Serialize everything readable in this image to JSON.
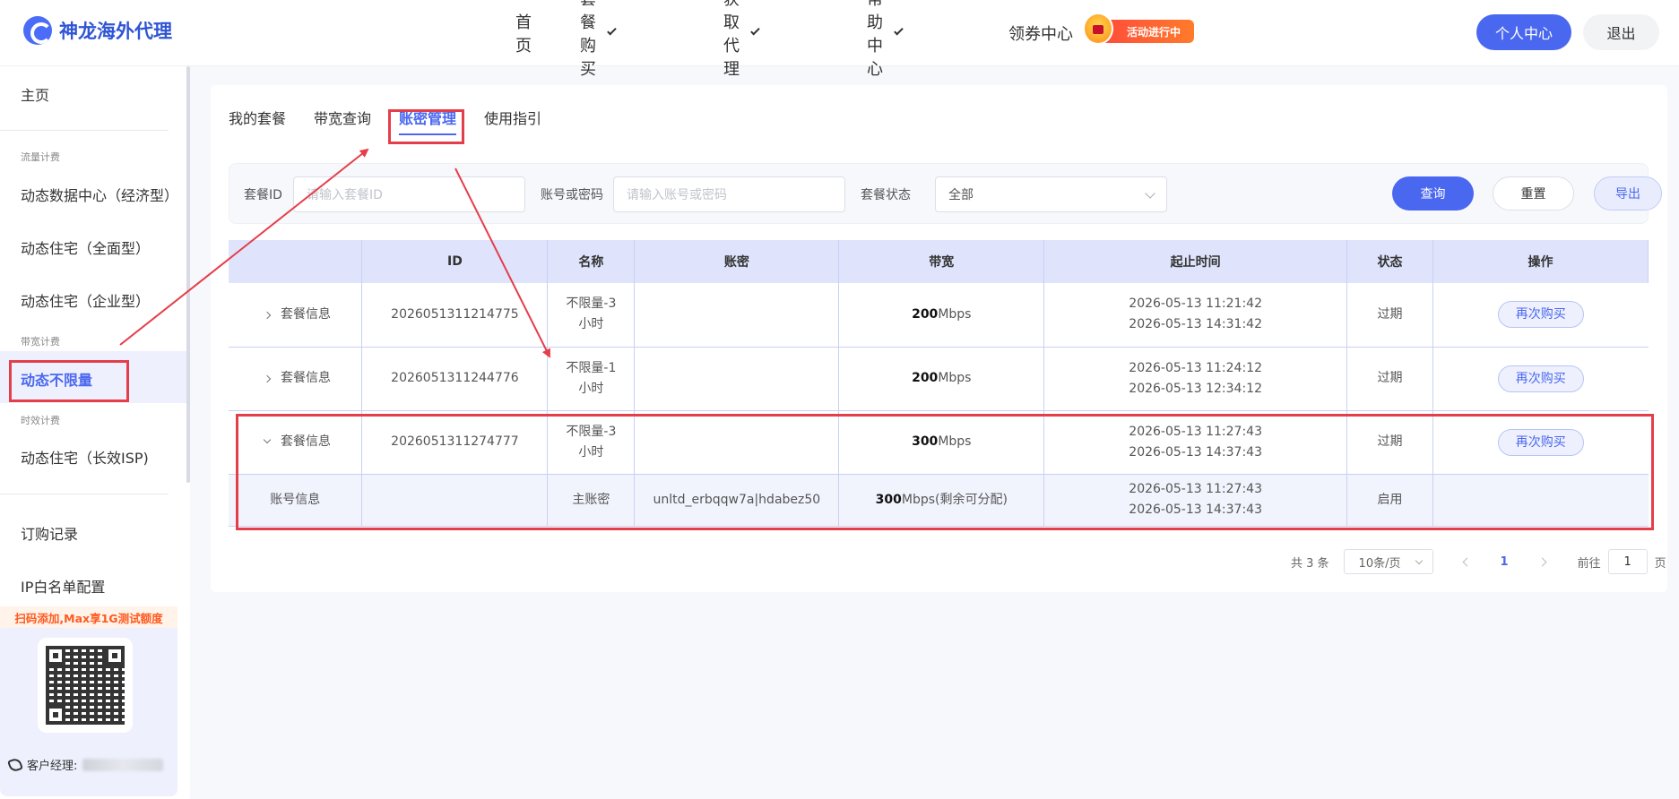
{
  "header": {
    "brand": "神龙海外代理",
    "nav": [
      {
        "label": "首页"
      },
      {
        "label": "套餐购买"
      },
      {
        "label": "获取代理"
      },
      {
        "label": "帮助中心"
      },
      {
        "label": "领券中心"
      }
    ],
    "promo_badge": "活动进行中",
    "user_center_button": "个人中心",
    "logout_button": "退出"
  },
  "sidebar": {
    "home": "主页",
    "group_traffic": "流量计费",
    "item_dynamic_center": "动态数据中心（经济型）",
    "item_residential_full": "动态住宅（全面型）",
    "item_residential_enterprise": "动态住宅（企业型）",
    "group_bandwidth": "带宽计费",
    "item_unlimited": "动态不限量",
    "group_time": "时效计费",
    "item_residential_isp": "动态住宅（长效ISP)",
    "orders": "订购记录",
    "ip_whitelist": "IP白名单配置",
    "promo_text": "扫码添加,Max享1G测试额度",
    "manager_label": "客户经理:"
  },
  "tabs": [
    "我的套餐",
    "带宽查询",
    "账密管理",
    "使用指引"
  ],
  "filters": {
    "package_id_label": "套餐ID",
    "package_id_placeholder": "请输入套餐ID",
    "account_label": "账号或密码",
    "account_placeholder": "请输入账号或密码",
    "status_label": "套餐状态",
    "status_value": "全部",
    "query_button": "查询",
    "reset_button": "重置",
    "export_button": "导出"
  },
  "table": {
    "headers": [
      "",
      "ID",
      "名称",
      "账密",
      "带宽",
      "起止时间",
      "状态",
      "操作"
    ],
    "rows": [
      {
        "expand_label": "套餐信息",
        "id": "2026051311214775",
        "name": "不限量-3小时",
        "account": "",
        "bw_value": "200",
        "bw_unit": "Mbps",
        "start": "2026-05-13 11:21:42",
        "end": "2026-05-13 14:31:42",
        "status": "过期",
        "action": "再次购买"
      },
      {
        "expand_label": "套餐信息",
        "id": "2026051311244776",
        "name": "不限量-1小时",
        "account": "",
        "bw_value": "200",
        "bw_unit": "Mbps",
        "start": "2026-05-13 11:24:12",
        "end": "2026-05-13 12:34:12",
        "status": "过期",
        "action": "再次购买"
      },
      {
        "expand_label": "套餐信息",
        "id": "2026051311274777",
        "name": "不限量-3小时",
        "account": "",
        "bw_value": "300",
        "bw_unit": "Mbps",
        "start": "2026-05-13 11:27:43",
        "end": "2026-05-13 14:37:43",
        "status": "过期",
        "action": "再次购买"
      }
    ],
    "sub_row": {
      "label": "账号信息",
      "name": "主账密",
      "account": "unltd_erbqqw7a|hdabez50",
      "bw_value": "300",
      "bw_unit": "Mbps(剩余可分配)",
      "start": "2026-05-13 11:27:43",
      "end": "2026-05-13 14:37:43",
      "status": "启用"
    }
  },
  "pagination": {
    "total": "共 3 条",
    "page_size": "10条/页",
    "current_page": "1",
    "goto_label": "前往",
    "goto_value": "1",
    "page_suffix": "页"
  },
  "colors": {
    "accent": "#4a67f0",
    "annotation": "#e53e4b"
  }
}
